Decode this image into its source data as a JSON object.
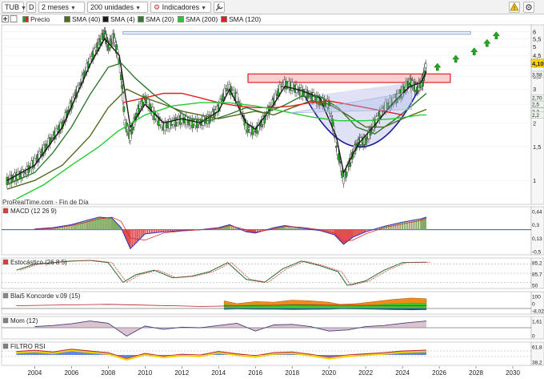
{
  "toolbar": {
    "ticker": "TUB",
    "period_code": "D",
    "timeframe": "2 meses",
    "units": "200 unidades",
    "indicators_label": "Indicadores"
  },
  "legend": {
    "price": "Precio",
    "sma40": "SMA (40)",
    "sma4": "SMA (4)",
    "sma20": "SMA (20)",
    "sma200": "SMA (200)",
    "sma120": "SMA (120)"
  },
  "watermark": "ProRealTime.com - Fin de Día",
  "colors": {
    "sma40": "#4f6b1e",
    "sma4": "#1a1a1a",
    "sma20": "#2f7a2f",
    "sma200": "#22cc33",
    "sma120": "#e02020",
    "up_arrow": "#1faa1f",
    "resistance_fill": "#f8d0d0",
    "resistance_stroke": "#dd2222",
    "target_fill": "#e6eef9",
    "target_stroke": "#7a9ad8",
    "cup": "#1a1a9a",
    "price_tag": "#ffd700"
  },
  "chart_data": [
    {
      "type": "line",
      "title": "",
      "x_unit": "year",
      "xlim": [
        2002.2,
        2031.0
      ],
      "ylim": [
        0.75,
        6.5
      ],
      "x_ticks": [
        "2004",
        "2006",
        "2008",
        "2010",
        "2012",
        "2014",
        "2016",
        "2018",
        "2020",
        "2022",
        "2024",
        "2026",
        "2028",
        "2030"
      ],
      "y_ticks": [
        "6",
        "5,5",
        "5",
        "4,5",
        "4",
        "3,5",
        "3",
        "2,5",
        "2",
        "1,5",
        "1"
      ],
      "y_tick_values": [
        6,
        5.5,
        5,
        4.5,
        4,
        3.5,
        3,
        2.5,
        2,
        1.5,
        1
      ],
      "last_price_label": "4,10",
      "last_price": 4.1,
      "right_labels": [
        {
          "text": "3,58",
          "value": 3.58
        },
        {
          "text": "2,70",
          "value": 2.7
        },
        {
          "text": "2,5",
          "value": 2.5
        },
        {
          "text": "2,3",
          "value": 2.3
        },
        {
          "text": "2,2",
          "value": 2.2
        }
      ],
      "series": [
        {
          "name": "Precio",
          "x": [
            2002.5,
            2003.0,
            2003.5,
            2004.0,
            2004.5,
            2005.0,
            2005.5,
            2006.0,
            2006.5,
            2007.0,
            2007.5,
            2007.8,
            2008.0,
            2008.3,
            2008.6,
            2008.9,
            2009.2,
            2009.6,
            2010.0,
            2010.5,
            2011.0,
            2011.5,
            2012.0,
            2012.5,
            2013.0,
            2013.5,
            2014.0,
            2014.5,
            2015.0,
            2015.5,
            2016.0,
            2016.5,
            2017.0,
            2017.5,
            2018.0,
            2018.5,
            2019.0,
            2019.5,
            2020.0,
            2020.4,
            2020.8,
            2021.2,
            2021.6,
            2022.0,
            2022.5,
            2023.0,
            2023.5,
            2024.0,
            2024.4,
            2024.8,
            2025.1,
            2025.3
          ],
          "values": [
            1.0,
            1.05,
            1.1,
            1.25,
            1.45,
            1.7,
            1.95,
            2.5,
            3.2,
            4.2,
            5.2,
            5.9,
            5.0,
            5.6,
            4.2,
            2.0,
            1.7,
            2.3,
            2.7,
            2.2,
            1.9,
            2.0,
            2.1,
            2.0,
            2.0,
            2.1,
            2.4,
            3.1,
            2.7,
            1.9,
            1.8,
            2.1,
            2.6,
            3.2,
            3.1,
            2.9,
            2.8,
            2.6,
            2.5,
            1.5,
            1.0,
            1.3,
            1.6,
            1.6,
            2.0,
            2.4,
            2.6,
            2.9,
            3.3,
            3.0,
            3.3,
            4.1
          ]
        },
        {
          "name": "SMA (4)",
          "x": [
            2002.5,
            2004.0,
            2005.5,
            2007.0,
            2007.8,
            2008.6,
            2009.2,
            2010.0,
            2011.0,
            2012.0,
            2013.0,
            2014.0,
            2014.6,
            2015.5,
            2016.0,
            2017.0,
            2017.6,
            2018.5,
            2019.5,
            2020.4,
            2020.8,
            2021.6,
            2022.5,
            2023.5,
            2024.4,
            2025.0,
            2025.3
          ],
          "values": [
            1.0,
            1.2,
            1.9,
            4.0,
            5.5,
            4.5,
            1.9,
            2.5,
            2.0,
            2.1,
            2.0,
            2.3,
            3.0,
            2.0,
            1.85,
            2.5,
            3.1,
            2.95,
            2.7,
            1.7,
            1.1,
            1.55,
            1.95,
            2.55,
            3.1,
            3.25,
            3.7
          ]
        },
        {
          "name": "SMA (20)",
          "x": [
            2002.5,
            2004.0,
            2005.0,
            2006.0,
            2007.0,
            2008.0,
            2008.7,
            2009.5,
            2010.5,
            2011.5,
            2012.5,
            2013.5,
            2014.5,
            2015.5,
            2016.5,
            2017.5,
            2018.5,
            2019.5,
            2020.5,
            2021.5,
            2022.5,
            2023.5,
            2024.5,
            2025.3
          ],
          "values": [
            0.95,
            1.1,
            1.4,
            1.9,
            2.8,
            3.9,
            4.1,
            3.4,
            2.8,
            2.4,
            2.1,
            2.05,
            2.2,
            2.4,
            2.25,
            2.45,
            2.75,
            2.75,
            2.4,
            1.9,
            1.75,
            2.05,
            2.45,
            2.85
          ]
        },
        {
          "name": "SMA (40)",
          "x": [
            2002.5,
            2004.0,
            2005.5,
            2007.0,
            2008.0,
            2009.0,
            2010.0,
            2011.0,
            2012.0,
            2013.0,
            2014.0,
            2015.0,
            2016.0,
            2017.0,
            2018.0,
            2019.0,
            2020.0,
            2021.0,
            2022.0,
            2023.0,
            2024.0,
            2025.3
          ],
          "values": [
            0.9,
            1.0,
            1.2,
            1.7,
            2.4,
            3.0,
            2.7,
            2.5,
            2.3,
            2.2,
            2.1,
            2.2,
            2.3,
            2.2,
            2.4,
            2.6,
            2.5,
            2.2,
            1.9,
            1.9,
            2.1,
            2.35
          ]
        },
        {
          "name": "SMA (120)",
          "x": [
            2008.8,
            2010.0,
            2011.0,
            2012.0,
            2013.0,
            2014.0,
            2015.0,
            2016.0,
            2017.0,
            2018.0,
            2019.0,
            2020.0,
            2021.0,
            2022.0,
            2023.0,
            2024.0
          ],
          "values": [
            2.55,
            2.7,
            2.85,
            2.85,
            2.7,
            2.55,
            2.45,
            2.4,
            2.4,
            2.45,
            2.55,
            2.6,
            2.5,
            2.4,
            2.3,
            2.2
          ]
        },
        {
          "name": "SMA (200)",
          "x": [
            2003.0,
            2004.5,
            2006.0,
            2007.5,
            2008.5,
            2010.0,
            2011.5,
            2013.0,
            2014.5,
            2016.0,
            2017.5,
            2019.0,
            2020.5,
            2022.0,
            2023.5,
            2025.0,
            2025.3
          ],
          "values": [
            0.8,
            0.95,
            1.2,
            1.5,
            1.8,
            2.2,
            2.45,
            2.55,
            2.55,
            2.45,
            2.3,
            2.15,
            2.05,
            2.05,
            2.1,
            2.2,
            2.2
          ]
        }
      ],
      "annotations": [
        {
          "kind": "rect",
          "x0": 2008.8,
          "x1": 2027.7,
          "y0": 5.8,
          "y1": 6.0
        },
        {
          "kind": "rect",
          "x0": 2015.6,
          "x1": 2026.6,
          "y0": 3.25,
          "y1": 3.6
        },
        {
          "kind": "up_arrows",
          "x": [
            2025.9,
            2026.9,
            2027.9,
            2028.6,
            2029.1
          ],
          "y": [
            3.9,
            4.3,
            4.7,
            5.2,
            5.7
          ]
        }
      ]
    },
    {
      "type": "bar",
      "title": "MACD (12 26 9)",
      "xlim": [
        2002.2,
        2031.0
      ],
      "ylim": [
        -0.6,
        0.55
      ],
      "y_ticks": [
        "0,44",
        "0,3",
        "0,13",
        "-0,5"
      ],
      "x": [
        2004,
        2005,
        2006,
        2006.8,
        2007.5,
        2008.2,
        2008.7,
        2009.2,
        2010,
        2011,
        2012,
        2013,
        2014,
        2014.6,
        2015.5,
        2016,
        2017,
        2017.6,
        2018.5,
        2019.5,
        2020.3,
        2020.8,
        2021.3,
        2022,
        2023,
        2024,
        2025,
        2025.3
      ],
      "values": [
        0.02,
        0.05,
        0.12,
        0.22,
        0.3,
        0.28,
        0.05,
        -0.45,
        -0.1,
        -0.05,
        -0.02,
        0.0,
        0.05,
        0.12,
        -0.05,
        -0.08,
        0.05,
        0.1,
        0.04,
        -0.02,
        -0.12,
        -0.35,
        -0.18,
        -0.05,
        0.08,
        0.18,
        0.26,
        0.3
      ],
      "signal": [
        0.01,
        0.03,
        0.1,
        0.18,
        0.26,
        0.3,
        0.2,
        -0.2,
        -0.25,
        -0.08,
        -0.03,
        0.0,
        0.03,
        0.1,
        0.0,
        -0.06,
        0.02,
        0.08,
        0.06,
        0.0,
        -0.08,
        -0.28,
        -0.25,
        -0.1,
        0.05,
        0.14,
        0.22,
        0.28
      ]
    },
    {
      "type": "line",
      "title": "Estocástico (26 8 5)",
      "xlim": [
        2002.2,
        2031.0
      ],
      "ylim": [
        0,
        100
      ],
      "y_ticks": [
        "85,2",
        "85,7",
        "50"
      ],
      "x": [
        2003,
        2004,
        2005,
        2006,
        2007,
        2008,
        2008.8,
        2009.5,
        2010.5,
        2011.5,
        2012.5,
        2013.5,
        2014.5,
        2015.5,
        2016.5,
        2017.5,
        2018.5,
        2019.5,
        2020.5,
        2021.0,
        2022.0,
        2023.0,
        2024.0,
        2025.3
      ],
      "values": [
        60,
        80,
        85,
        90,
        92,
        85,
        20,
        45,
        60,
        35,
        40,
        55,
        85,
        30,
        20,
        65,
        90,
        75,
        55,
        10,
        25,
        60,
        85,
        86
      ]
    },
    {
      "type": "area",
      "title": "Blai5 Koncorde v.09 (15)",
      "xlim": [
        2002.2,
        2031.0
      ],
      "ylim": [
        -40,
        120
      ],
      "y_ticks": [
        "100",
        "0",
        "-8,02"
      ],
      "x": [
        2014.3,
        2015,
        2016,
        2017,
        2018,
        2019,
        2020,
        2020.6,
        2021.5,
        2022.5,
        2023.5,
        2024.5,
        2025.3
      ],
      "values": [
        55,
        35,
        50,
        45,
        60,
        55,
        45,
        30,
        35,
        50,
        65,
        75,
        70
      ]
    },
    {
      "type": "line",
      "title": "Mom (12)",
      "xlim": [
        2002.2,
        2031.0
      ],
      "ylim": [
        -2,
        2
      ],
      "y_ticks": [
        "1,61",
        "0"
      ],
      "x": [
        2004,
        2005,
        2006,
        2007,
        2008,
        2009,
        2010,
        2011,
        2012,
        2013,
        2014,
        2015,
        2016,
        2017,
        2018,
        2019,
        2020,
        2021,
        2022,
        2023,
        2024,
        2025.3
      ],
      "values": [
        0.2,
        0.4,
        0.7,
        1.2,
        0.8,
        -1.5,
        0.3,
        -0.3,
        0.1,
        0.0,
        0.4,
        0.8,
        -0.6,
        0.5,
        0.6,
        0.2,
        -0.6,
        -0.4,
        0.2,
        0.4,
        0.8,
        1.2
      ]
    },
    {
      "type": "area",
      "title": "FILTRO RSI",
      "xlim": [
        2002.2,
        2031.0
      ],
      "ylim": [
        0,
        100
      ],
      "y_ticks": [
        "61,8",
        "38,2"
      ],
      "x": [
        2003,
        2004,
        2005,
        2006,
        2007,
        2008,
        2009,
        2010,
        2011,
        2012,
        2013,
        2014,
        2015,
        2016,
        2017,
        2018,
        2019,
        2020,
        2021,
        2022,
        2023,
        2024,
        2025.3
      ],
      "values": [
        60,
        65,
        58,
        70,
        62,
        55,
        30,
        52,
        40,
        48,
        45,
        60,
        50,
        42,
        55,
        58,
        48,
        35,
        45,
        50,
        55,
        62,
        66
      ]
    }
  ]
}
